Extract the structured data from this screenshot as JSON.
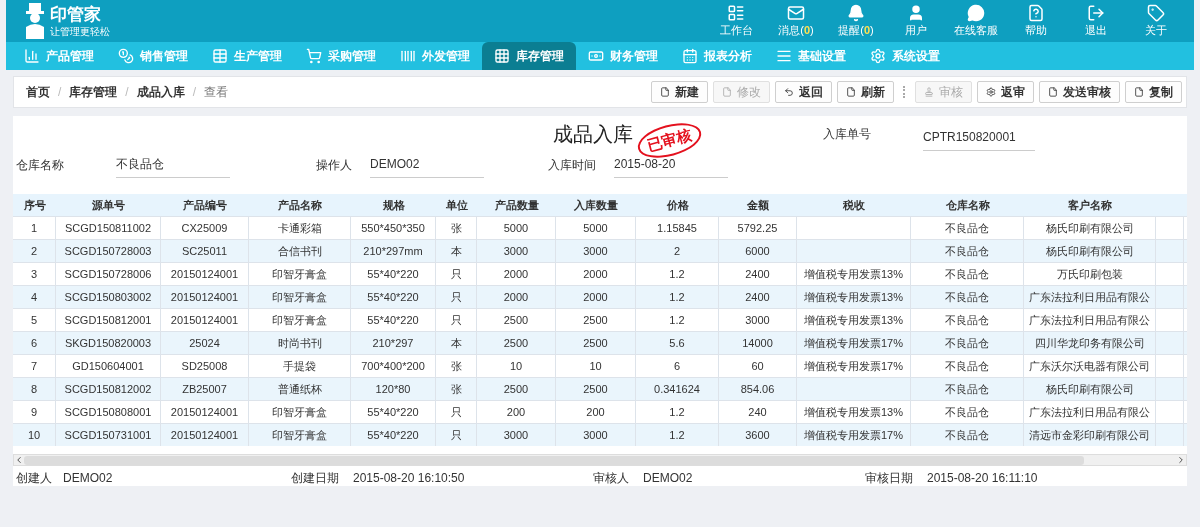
{
  "logo": {
    "name": "印管家",
    "slogan": "让管理更轻松"
  },
  "top_menu": [
    {
      "label": "工作台"
    },
    {
      "label": "消息(",
      "count": "0",
      "suffix": ")"
    },
    {
      "label": "提醒(",
      "count": "0",
      "suffix": ")"
    },
    {
      "label": "用户"
    },
    {
      "label": "在线客服"
    },
    {
      "label": "帮助"
    },
    {
      "label": "退出"
    },
    {
      "label": "关于"
    }
  ],
  "nav": [
    {
      "label": "产品管理",
      "selected": false
    },
    {
      "label": "销售管理",
      "selected": false
    },
    {
      "label": "生产管理",
      "selected": false
    },
    {
      "label": "采购管理",
      "selected": false
    },
    {
      "label": "外发管理",
      "selected": false
    },
    {
      "label": "库存管理",
      "selected": true
    },
    {
      "label": "财务管理",
      "selected": false
    },
    {
      "label": "报表分析",
      "selected": false
    },
    {
      "label": "基础设置",
      "selected": false
    },
    {
      "label": "系统设置",
      "selected": false
    }
  ],
  "breadcrumb": {
    "separator": "/",
    "items": [
      "首页",
      "库存管理",
      "成品入库",
      "查看"
    ]
  },
  "toolbar": [
    {
      "kind": "button",
      "label": "新建",
      "disabled": false
    },
    {
      "kind": "button",
      "label": "修改",
      "disabled": true
    },
    {
      "kind": "button",
      "label": "返回",
      "disabled": false
    },
    {
      "kind": "button",
      "label": "刷新",
      "disabled": false
    },
    {
      "kind": "separator"
    },
    {
      "kind": "button",
      "label": "审核",
      "disabled": true
    },
    {
      "kind": "button",
      "label": "返审",
      "disabled": false
    },
    {
      "kind": "button",
      "label": "发送审核",
      "disabled": false
    },
    {
      "kind": "button",
      "label": "复制",
      "disabled": false
    }
  ],
  "form": {
    "title": "成品入库",
    "stamp": "已审核",
    "order_no": {
      "label": "入库单号",
      "value": "CPTR150820001"
    },
    "fields": [
      {
        "label": "仓库名称",
        "value": "不良品仓"
      },
      {
        "label": "操作人",
        "value": "DEMO02"
      },
      {
        "label": "入库时间",
        "value": "2015-08-20"
      }
    ]
  },
  "table": {
    "columns": [
      "序号",
      "源单号",
      "产品编号",
      "产品名称",
      "规格",
      "单位",
      "产品数量",
      "入库数量",
      "价格",
      "金额",
      "税收",
      "仓库名称",
      "客户名称"
    ],
    "rows": [
      [
        "1",
        "SCGD150811002",
        "CX25009",
        "卡通彩箱",
        "550*450*350",
        "张",
        "5000",
        "5000",
        "1.15845",
        "5792.25",
        "",
        "不良品仓",
        "杨氏印刷有限公司"
      ],
      [
        "2",
        "SCGD150728003",
        "SC25011",
        "合信书刊",
        "210*297mm",
        "本",
        "3000",
        "3000",
        "2",
        "6000",
        "",
        "不良品仓",
        "杨氏印刷有限公司"
      ],
      [
        "3",
        "SCGD150728006",
        "20150124001",
        "印智牙膏盒",
        "55*40*220",
        "只",
        "2000",
        "2000",
        "1.2",
        "2400",
        "增值税专用发票13%",
        "不良品仓",
        "万氏印刷包装"
      ],
      [
        "4",
        "SCGD150803002",
        "20150124001",
        "印智牙膏盒",
        "55*40*220",
        "只",
        "2000",
        "2000",
        "1.2",
        "2400",
        "增值税专用发票13%",
        "不良品仓",
        "广东法拉利日用品有限公"
      ],
      [
        "5",
        "SCGD150812001",
        "20150124001",
        "印智牙膏盒",
        "55*40*220",
        "只",
        "2500",
        "2500",
        "1.2",
        "3000",
        "增值税专用发票13%",
        "不良品仓",
        "广东法拉利日用品有限公"
      ],
      [
        "6",
        "SKGD150820003",
        "25024",
        "时尚书刊",
        "210*297",
        "本",
        "2500",
        "2500",
        "5.6",
        "14000",
        "增值税专用发票17%",
        "不良品仓",
        "四川华龙印务有限公司"
      ],
      [
        "7",
        "GD150604001",
        "SD25008",
        "手提袋",
        "700*400*200",
        "张",
        "10",
        "10",
        "6",
        "60",
        "增值税专用发票17%",
        "不良品仓",
        "广东沃尔沃电器有限公司"
      ],
      [
        "8",
        "SCGD150812002",
        "ZB25007",
        "普通纸杯",
        "120*80",
        "张",
        "2500",
        "2500",
        "0.341624",
        "854.06",
        "",
        "不良品仓",
        "杨氏印刷有限公司"
      ],
      [
        "9",
        "SCGD150808001",
        "20150124001",
        "印智牙膏盒",
        "55*40*220",
        "只",
        "200",
        "200",
        "1.2",
        "240",
        "增值税专用发票13%",
        "不良品仓",
        "广东法拉利日用品有限公"
      ],
      [
        "10",
        "SCGD150731001",
        "20150124001",
        "印智牙膏盒",
        "55*40*220",
        "只",
        "3000",
        "3000",
        "1.2",
        "3600",
        "增值税专用发票17%",
        "不良品仓",
        "清远市金彩印刷有限公司"
      ]
    ]
  },
  "footer": [
    {
      "label": "创建人",
      "value": "DEMO02"
    },
    {
      "label": "创建日期",
      "value": "2015-08-20 16:10:50"
    },
    {
      "label": "审核人",
      "value": "DEMO02"
    },
    {
      "label": "审核日期",
      "value": "2015-08-20 16:11:10"
    }
  ]
}
